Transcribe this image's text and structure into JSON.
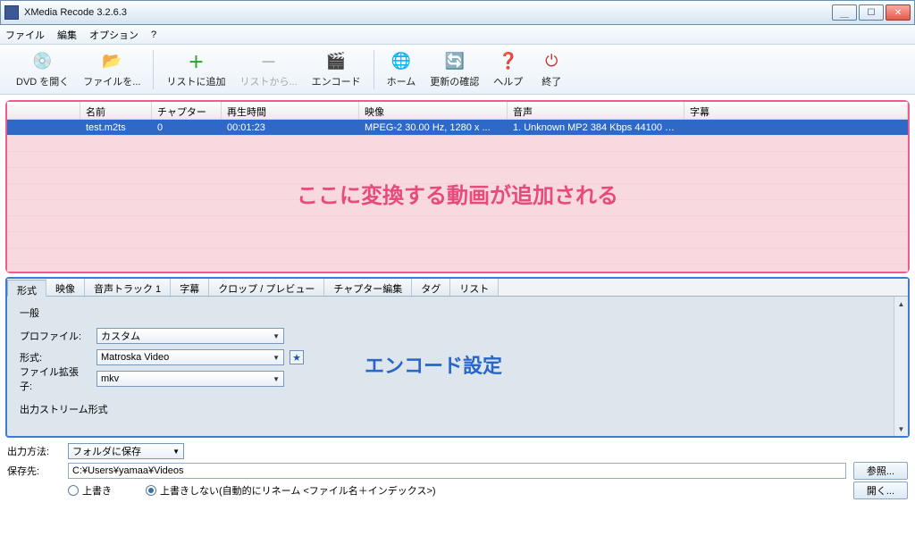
{
  "window": {
    "title": "XMedia Recode 3.2.6.3"
  },
  "menu": {
    "file": "ファイル",
    "edit": "編集",
    "options": "オプション",
    "help": "?"
  },
  "toolbar": {
    "open_dvd": "DVD を開く",
    "open_file": "ファイルを...",
    "add_list": "リストに追加",
    "remove_list": "リストから...",
    "encode": "エンコード",
    "home": "ホーム",
    "update": "更新の確認",
    "helpbtn": "ヘルプ",
    "exit": "終了"
  },
  "columns": {
    "name": "名前",
    "chapter": "チャプター",
    "duration": "再生時間",
    "video": "映像",
    "audio": "音声",
    "subtitle": "字幕"
  },
  "rows": [
    {
      "name": "test.m2ts",
      "chapter": "0",
      "duration": "00:01:23",
      "video": "MPEG-2 30.00 Hz, 1280 x ...",
      "audio": "1. Unknown MP2 384 Kbps 44100 Hz...",
      "subtitle": ""
    }
  ],
  "annotations": {
    "list": "ここに変換する動画が追加される",
    "encode": "エンコード設定"
  },
  "tabs": {
    "format": "形式",
    "video": "映像",
    "audio": "音声トラック 1",
    "subtitle": "字幕",
    "crop": "クロップ / プレビュー",
    "chapter": "チャプター編集",
    "tag": "タグ",
    "list": "リスト"
  },
  "settings": {
    "general_title": "一般",
    "profile_label": "プロファイル:",
    "profile_value": "カスタム",
    "format_label": "形式:",
    "format_value": "Matroska Video",
    "ext_label": "ファイル拡張子:",
    "ext_value": "mkv",
    "outstream_title": "出力ストリーム形式"
  },
  "output": {
    "method_label": "出力方法:",
    "method_value": "フォルダに保存",
    "dest_label": "保存先:",
    "dest_value": "C:¥Users¥yamaa¥Videos",
    "browse": "参照...",
    "open": "開く...",
    "overwrite": "上書き",
    "no_overwrite": "上書きしない(自動的にリネーム <ファイル名＋インデックス>)"
  }
}
